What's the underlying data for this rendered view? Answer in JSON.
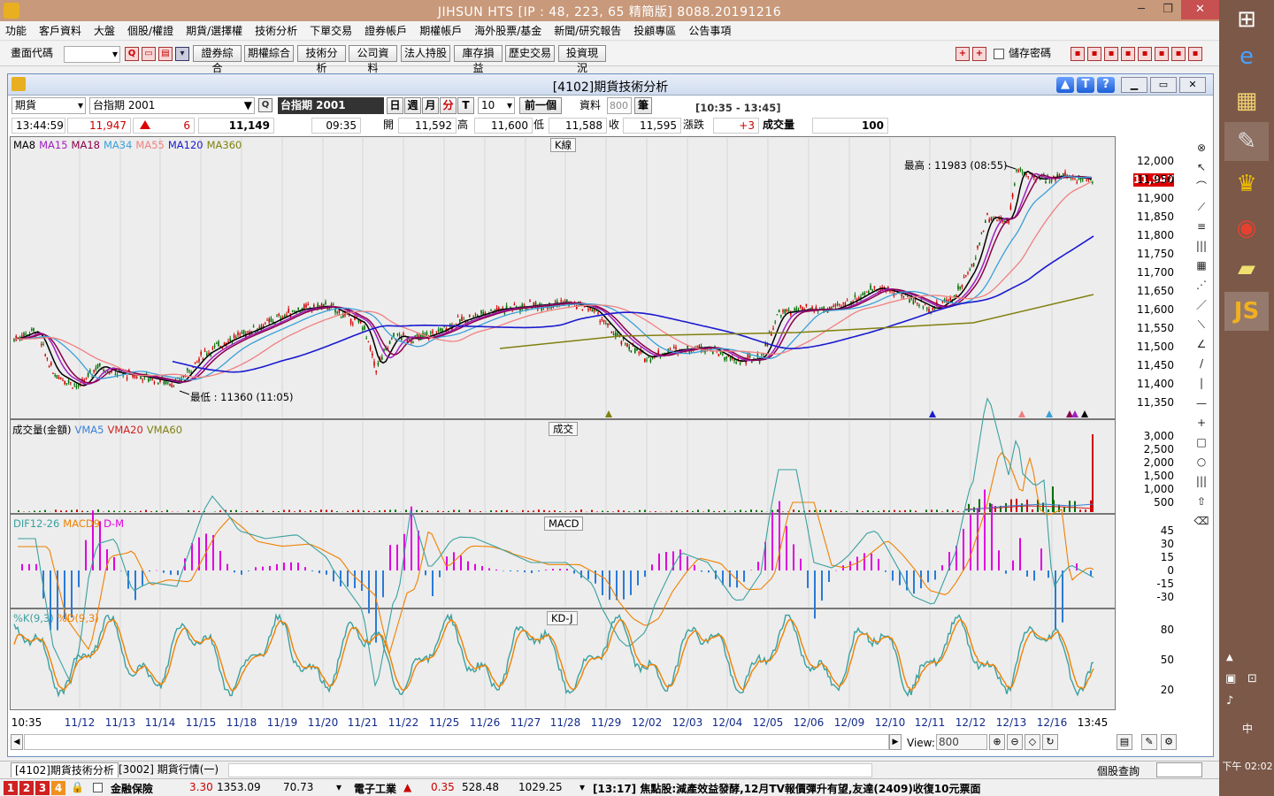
{
  "window": {
    "title": "JIHSUN HTS     [IP : 48, 223, 65 精簡版] 8088.20191216"
  },
  "menu": [
    "功能",
    "客戶資料",
    "大盤",
    "個股/權證",
    "期貨/選擇權",
    "技術分析",
    "下單交易",
    "證券帳戶",
    "期權帳戶",
    "海外股票/基金",
    "新聞/研究報告",
    "投顧專區",
    "公告事項"
  ],
  "toolbar": {
    "code_label": "畫面代碼",
    "buttons": [
      "證券綜合",
      "期權綜合",
      "技術分析",
      "公司資料",
      "法人持股",
      "庫存損益",
      "歷史交易",
      "投資現況"
    ],
    "save_pw": "儲存密碼"
  },
  "child": {
    "title": "[4102]期貨技術分析"
  },
  "controls": {
    "market": "期貨",
    "symbol": "台指期 2001",
    "symbol_dark": "台指期 2001",
    "periods": [
      "日",
      "週",
      "月",
      "分",
      "T"
    ],
    "period_active": "分",
    "interval": "10",
    "prev": "前一個",
    "data_label": "資料",
    "data_count": "800",
    "unit": "筆",
    "range": "[10:35 - 13:45]"
  },
  "quote": {
    "time": "13:44:59",
    "price": "11,947",
    "change": "6",
    "volume_total": "11,149",
    "bar_time": "09:35",
    "open_label": "開",
    "open": "11,592",
    "high_label": "高",
    "high": "11,600",
    "low_label": "低",
    "low": "11,588",
    "close_label": "收",
    "close": "11,595",
    "chg_label": "漲跌",
    "chg": "+3",
    "vol_label": "成交量",
    "vol": "100"
  },
  "kpanel": {
    "title": "K線",
    "legend": [
      {
        "name": "MA8",
        "color": "#000000"
      },
      {
        "name": "MA15",
        "color": "#a020c0"
      },
      {
        "name": "MA18",
        "color": "#8b004b"
      },
      {
        "name": "MA34",
        "color": "#3aa0d8"
      },
      {
        "name": "MA55",
        "color": "#f08080"
      },
      {
        "name": "MA120",
        "color": "#1a1ad0"
      },
      {
        "name": "MA360",
        "color": "#808010"
      }
    ],
    "high_note": "最高 : 11983 (08:55)",
    "low_note": "最低 : 11360 (11:05)",
    "last": "11,947",
    "yticks": [
      "12,000",
      "11,950",
      "11,900",
      "11,850",
      "11,800",
      "11,750",
      "11,700",
      "11,650",
      "11,600",
      "11,550",
      "11,500",
      "11,450",
      "11,400",
      "11,350"
    ]
  },
  "volpanel": {
    "title": "成交",
    "legend": [
      {
        "name": "成交量(金額)",
        "color": "#000000"
      },
      {
        "name": "VMA5",
        "color": "#3a80d8"
      },
      {
        "name": "VMA20",
        "color": "#d02020"
      },
      {
        "name": "VMA60",
        "color": "#808010"
      }
    ],
    "yticks": [
      "3,000",
      "2,500",
      "2,000",
      "1,500",
      "1,000",
      "500"
    ]
  },
  "macdpanel": {
    "title": "MACD",
    "legend": [
      {
        "name": "DIF12-26",
        "color": "#3aa0a0"
      },
      {
        "name": "MACD9",
        "color": "#f08000"
      },
      {
        "name": "D-M",
        "color": "#e000e0"
      }
    ],
    "yticks": [
      "45",
      "30",
      "15",
      "0",
      "-15",
      "-30"
    ]
  },
  "kdpanel": {
    "title": "KD-J",
    "legend": [
      {
        "name": "%K(9,3)",
        "color": "#3aa0a0"
      },
      {
        "name": "%D(9,3)",
        "color": "#f08000"
      }
    ],
    "yticks": [
      "80",
      "50",
      "20"
    ]
  },
  "xaxis": [
    "10:35",
    "11/12",
    "11/13",
    "11/14",
    "11/15",
    "11/18",
    "11/19",
    "11/20",
    "11/21",
    "11/22",
    "11/25",
    "11/26",
    "11/27",
    "11/28",
    "11/29",
    "12/02",
    "12/03",
    "12/04",
    "12/05",
    "12/06",
    "12/09",
    "12/10",
    "12/11",
    "12/12",
    "12/13",
    "12/16",
    "13:45"
  ],
  "bottom": {
    "view_label": "View:",
    "view_value": "800"
  },
  "tabs": [
    "[4102]期貨技術分析",
    "[3002] 期貨行情(一)"
  ],
  "stock_query": "個股查詢",
  "ticker": {
    "nums": [
      "1",
      "2",
      "3",
      "4"
    ],
    "item1": "金融保險",
    "v1a": "3.30",
    "v1b": "1353.09",
    "v1c": "70.73",
    "item2": "電子工業",
    "v2a": "0.35",
    "v2b": "528.48",
    "v2c": "1029.25",
    "news": "[13:17] 焦點股:減產效益發酵,12月TV報價彈升有望,友達(2409)收復10元票面"
  },
  "clock": "下午 02:02",
  "colors": {
    "titlebar": "#c8997a",
    "panel_bg": "#ededed",
    "up": "#d00000",
    "down": "#007000"
  }
}
